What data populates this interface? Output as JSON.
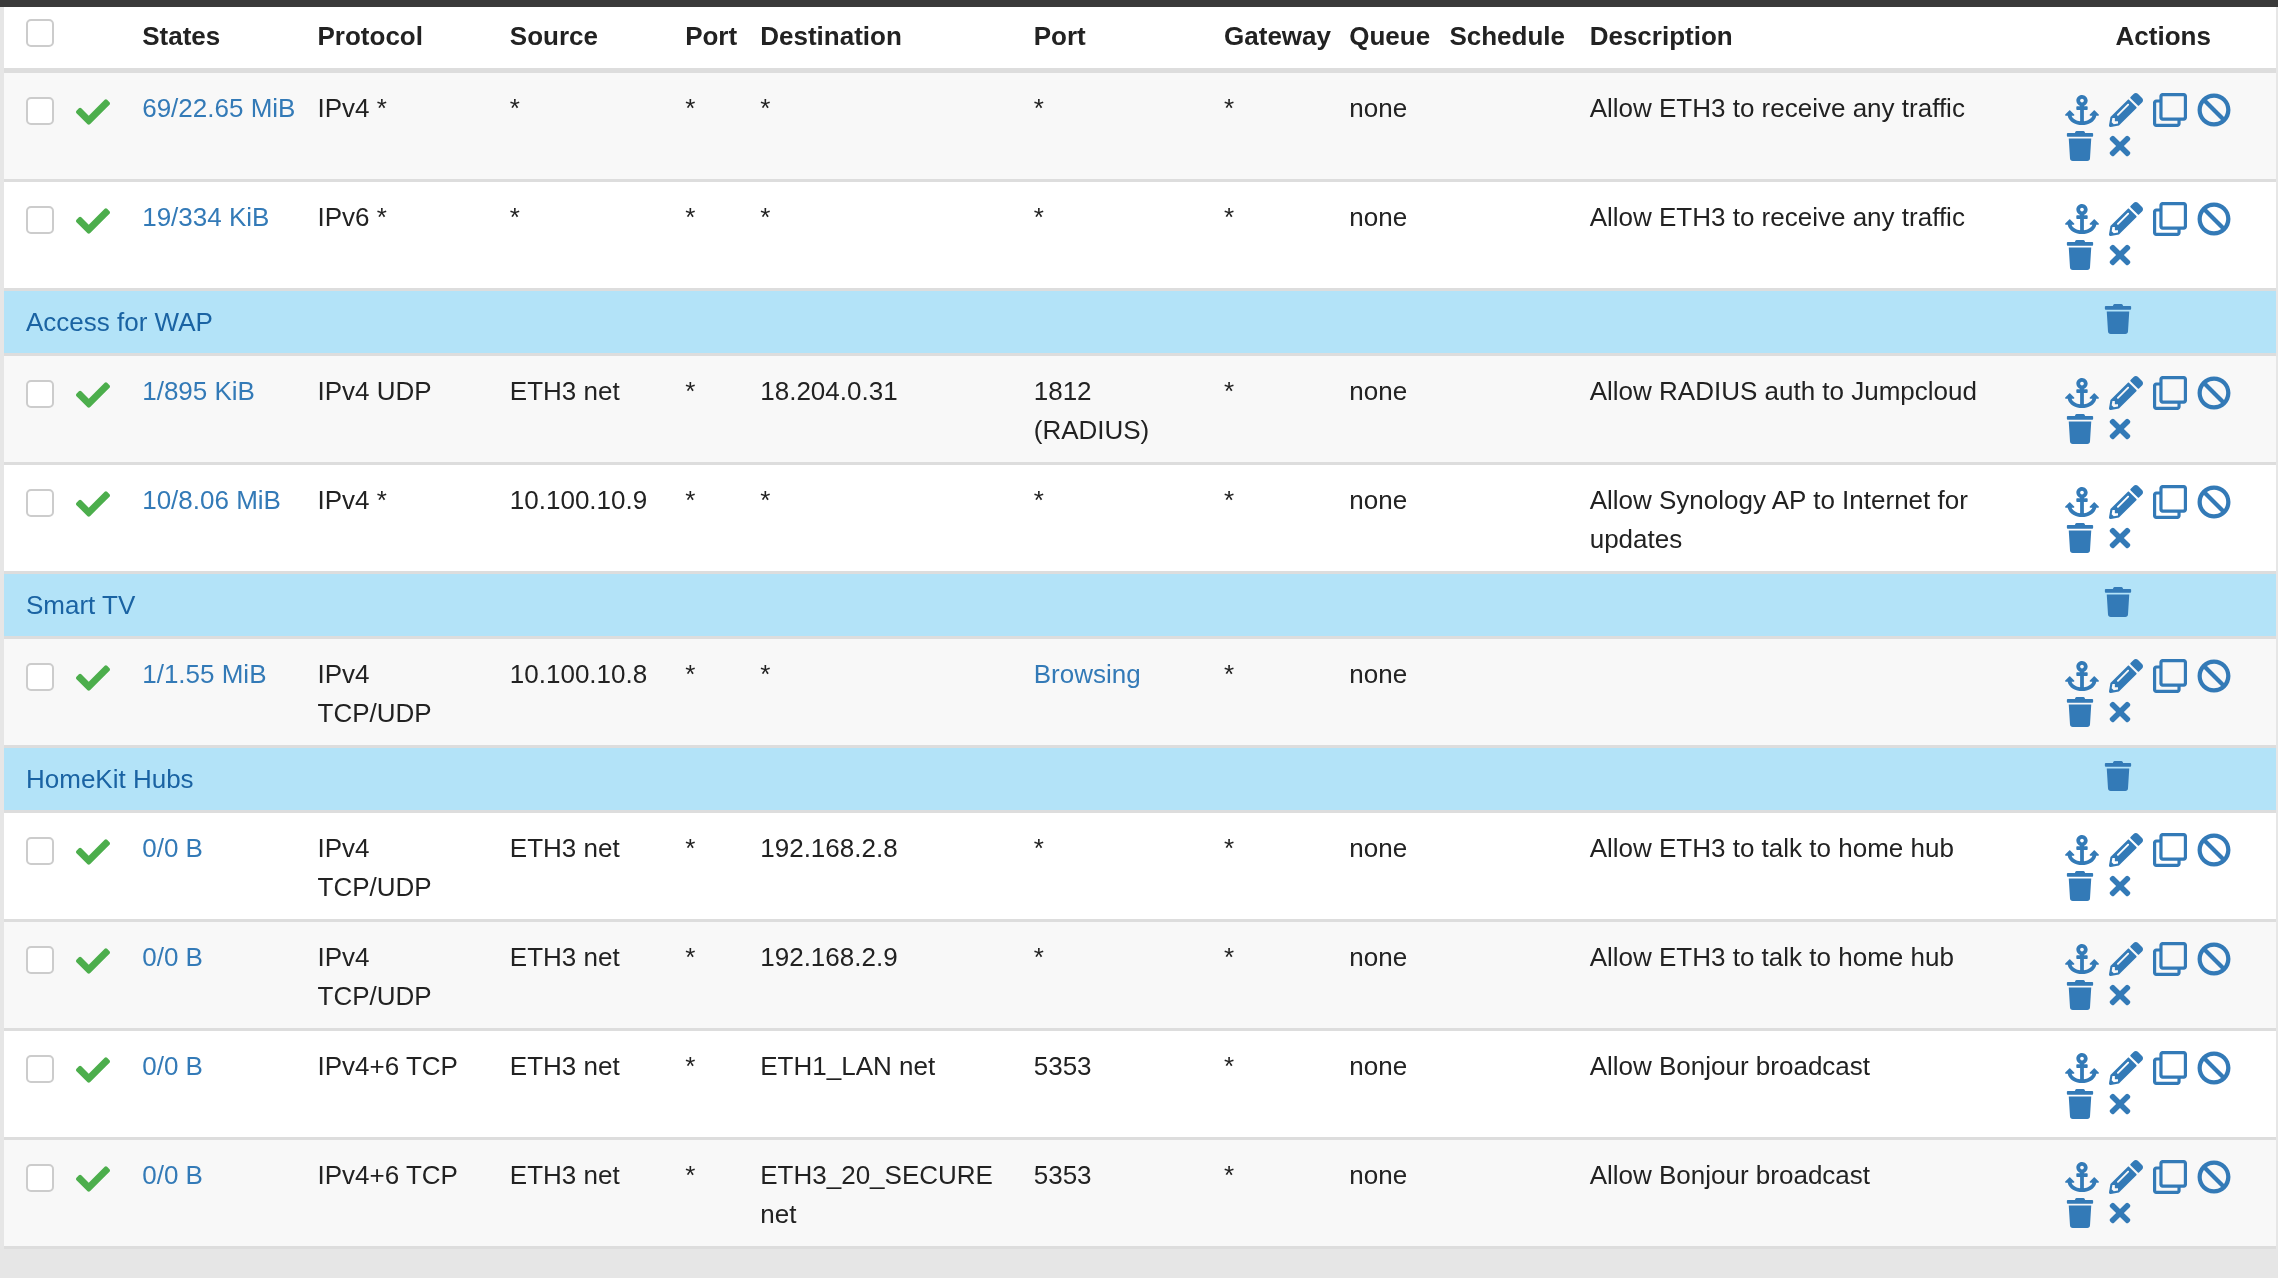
{
  "table": {
    "select_all": false,
    "columns": [
      "States",
      "Protocol",
      "Source",
      "Port",
      "Destination",
      "Port",
      "Gateway",
      "Queue",
      "Schedule",
      "Description",
      "Actions"
    ],
    "rows": [
      {
        "kind": "rule",
        "selected": false,
        "states": "69/22.65 MiB",
        "protocol": "IPv4 *",
        "source": "*",
        "port": "*",
        "destination": "*",
        "dest_port": "*",
        "dest_port_alias": false,
        "gateway": "*",
        "queue": "none",
        "description": "Allow ETH3 to receive any traffic"
      },
      {
        "kind": "rule",
        "selected": false,
        "states": "19/334 KiB",
        "protocol": "IPv6 *",
        "source": "*",
        "port": "*",
        "destination": "*",
        "dest_port": "*",
        "dest_port_alias": false,
        "gateway": "*",
        "queue": "none",
        "description": "Allow ETH3 to receive any traffic"
      },
      {
        "kind": "separator",
        "label": "Access for WAP"
      },
      {
        "kind": "rule",
        "selected": false,
        "states": "1/895 KiB",
        "protocol": "IPv4 UDP",
        "source": "ETH3 net",
        "port": "*",
        "destination": "18.204.0.31",
        "dest_port": "1812 (RADIUS)",
        "dest_port_alias": false,
        "gateway": "*",
        "queue": "none",
        "description": "Allow RADIUS auth to Jumpcloud"
      },
      {
        "kind": "rule",
        "selected": false,
        "states": "10/8.06 MiB",
        "protocol": "IPv4 *",
        "source": "10.100.10.9",
        "port": "*",
        "destination": "*",
        "dest_port": "*",
        "dest_port_alias": false,
        "gateway": "*",
        "queue": "none",
        "description": "Allow Synology AP to Internet for updates"
      },
      {
        "kind": "separator",
        "label": "Smart TV"
      },
      {
        "kind": "rule",
        "selected": false,
        "states": "1/1.55 MiB",
        "protocol": "IPv4 TCP/UDP",
        "source": "10.100.10.8",
        "port": "*",
        "destination": "*",
        "dest_port": "Browsing",
        "dest_port_alias": true,
        "gateway": "*",
        "queue": "none"
      },
      {
        "kind": "separator",
        "label": "HomeKit Hubs"
      },
      {
        "kind": "rule",
        "selected": false,
        "states": "0/0 B",
        "protocol": "IPv4 TCP/UDP",
        "source": "ETH3 net",
        "port": "*",
        "destination": "192.168.2.8",
        "dest_port": "*",
        "dest_port_alias": false,
        "gateway": "*",
        "queue": "none",
        "description": "Allow ETH3 to talk to home hub"
      },
      {
        "kind": "rule",
        "selected": false,
        "states": "0/0 B",
        "protocol": "IPv4 TCP/UDP",
        "source": "ETH3 net",
        "port": "*",
        "destination": "192.168.2.9",
        "dest_port": "*",
        "dest_port_alias": false,
        "gateway": "*",
        "queue": "none",
        "description": "Allow ETH3 to talk to home hub"
      },
      {
        "kind": "rule",
        "selected": false,
        "states": "0/0 B",
        "protocol": "IPv4+6 TCP",
        "source": "ETH3 net",
        "port": "*",
        "destination": "ETH1_LAN net",
        "dest_port": "5353",
        "dest_port_alias": false,
        "gateway": "*",
        "queue": "none",
        "description": "Allow Bonjour broadcast"
      },
      {
        "kind": "rule",
        "selected": false,
        "states": "0/0 B",
        "protocol": "IPv4+6 TCP",
        "source": "ETH3 net",
        "port": "*",
        "destination": "ETH3_20_SECURE net",
        "dest_port": "5353",
        "dest_port_alias": false,
        "gateway": "*",
        "queue": "none",
        "description": "Allow Bonjour broadcast"
      }
    ]
  }
}
